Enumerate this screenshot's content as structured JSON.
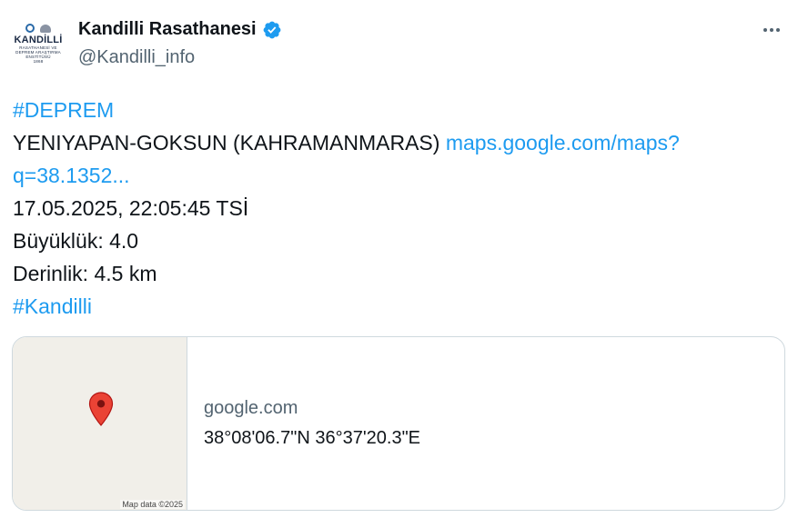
{
  "author": {
    "display_name": "Kandilli Rasathanesi",
    "handle": "@Kandilli_info",
    "avatar_logo_main": "KANDİLLİ",
    "avatar_logo_sub": "RASATHANESİ VE\nDEPREM ARAŞTIRMA\nENSTİTÜSÜ\n1868",
    "verified_icon": "verified-badge-icon",
    "verified_color": "#1d9bf0"
  },
  "menu": {
    "icon": "more-horizontal-icon"
  },
  "tweet": {
    "hashtag_top": "#DEPREM",
    "location": "YENIYAPAN-GOKSUN (KAHRAMANMARAS) ",
    "link_part1": "maps.google.com/maps?",
    "link_part2": "q=38.1352...",
    "datetime": "17.05.2025, 22:05:45 TSİ",
    "magnitude": "Büyüklük: 4.0",
    "depth": "Derinlik: 4.5 km",
    "hashtag_bottom": "#Kandilli",
    "link_color": "#1d9bf0"
  },
  "card": {
    "map_attribution": "Map data ©2025",
    "map_pin_icon": "map-pin-icon",
    "map_pin_color": "#ea4335",
    "domain": "google.com",
    "title": "38°08'06.7\"N 36°37'20.3\"E"
  }
}
